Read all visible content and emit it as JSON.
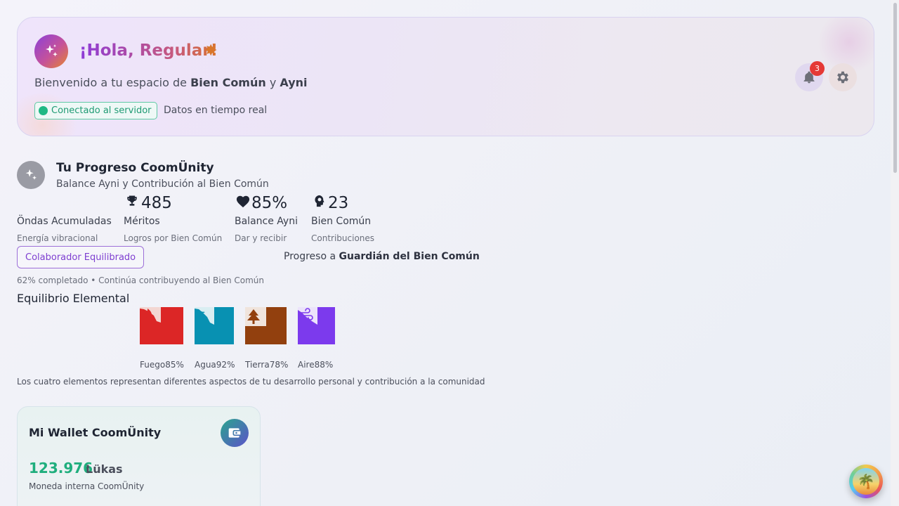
{
  "header": {
    "greeting": "¡Hola, Regular!",
    "greeting_emoji": "🌟",
    "welcome_prefix": "Bienvenido a tu espacio de ",
    "welcome_bold_1": "Bien Común",
    "welcome_mid": " y ",
    "welcome_bold_2": "Ayni",
    "connection_status": "Conectado al servidor",
    "data_status": "Datos en tiempo real",
    "notifications_count": "3",
    "icons": [
      "sparkles-icon",
      "bell-icon",
      "gear-icon"
    ]
  },
  "progress": {
    "title": "Tu Progreso CoomÜnity",
    "subtitle": "Balance Ayni y Contribución al Bien Común",
    "stats": [
      {
        "value": "",
        "label": "Öndas Acumuladas",
        "desc": "Energía vibracional",
        "icon": ""
      },
      {
        "value": "485",
        "label": "Méritos",
        "desc": "Logros por Bien Común",
        "icon": "trophy-icon"
      },
      {
        "value": "85%",
        "label": "Balance Ayni",
        "desc": "Dar y recibir",
        "icon": "heart-icon"
      },
      {
        "value": "23",
        "label": "Bien Común",
        "desc": "Contribuciones",
        "icon": "gear-head-icon"
      }
    ],
    "level_chip": "Colaborador Equilibrado",
    "next_level_prefix": "Progreso a ",
    "next_level_name": "Guardián del Bien Común",
    "completed_text": "62% completado • Continúa contribuyendo al Bien Común",
    "completed_fraction": 0.62
  },
  "elements": {
    "title": "Equilibrio Elemental",
    "items": [
      {
        "name": "Fuego",
        "percent_label": "85%",
        "level": 0.85,
        "color": "#dc2626",
        "icon": "fire-icon"
      },
      {
        "name": "Agua",
        "percent_label": "92%",
        "level": 0.92,
        "color": "#0891b2",
        "icon": "water-icon"
      },
      {
        "name": "Tierra",
        "percent_label": "78%",
        "level": 0.78,
        "color": "#92400e",
        "icon": "tree-icon"
      },
      {
        "name": "Aire",
        "percent_label": "88%",
        "level": 0.88,
        "color": "#7c3aed",
        "icon": "wind-icon"
      }
    ],
    "note": "Los cuatro elementos representan diferentes aspectos de tu desarrollo personal y contribución a la comunidad"
  },
  "wallet": {
    "title": "Mi Wallet CoomÜnity",
    "amount": "123.976",
    "unit": "Lükas",
    "desc": "Moneda interna CoomÜnity",
    "icon": "wallet-icon"
  },
  "colors": {
    "accent": "#8b3fd9",
    "success": "#1fae7d",
    "badge": "#e53935"
  }
}
